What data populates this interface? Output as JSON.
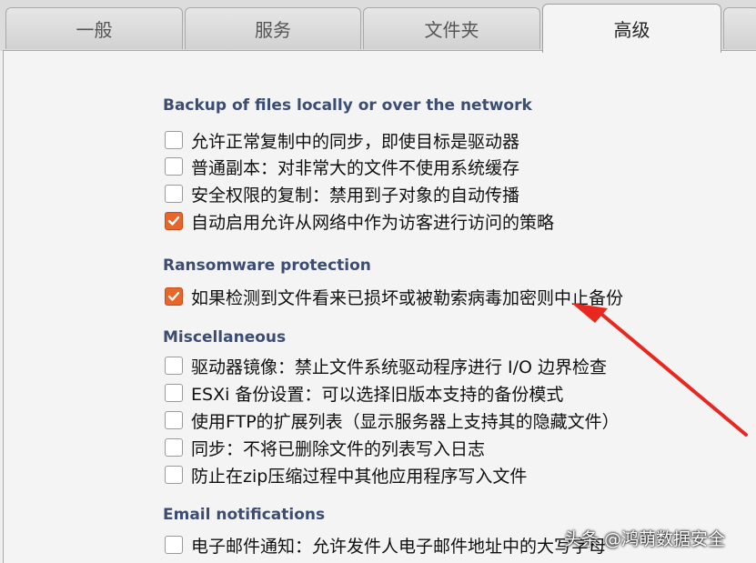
{
  "tabs": [
    {
      "label": "一般",
      "active": false
    },
    {
      "label": "服务",
      "active": false
    },
    {
      "label": "文件夹",
      "active": false
    },
    {
      "label": "高级",
      "active": true
    }
  ],
  "sections": {
    "backup": {
      "title": "Backup of files locally or over the network",
      "options": [
        {
          "label": "允许正常复制中的同步，即使目标是驱动器",
          "checked": false
        },
        {
          "label": "普通副本：对非常大的文件不使用系统缓存",
          "checked": false
        },
        {
          "label": "安全权限的复制：禁用到子对象的自动传播",
          "checked": false
        },
        {
          "label": "自动启用允许从网络中作为访客进行访问的策略",
          "checked": true
        }
      ]
    },
    "ransomware": {
      "title": "Ransomware protection",
      "options": [
        {
          "label": "如果检测到文件看来已损坏或被勒索病毒加密则中止备份",
          "checked": true
        }
      ]
    },
    "misc": {
      "title": "Miscellaneous",
      "options": [
        {
          "label": "驱动器镜像：禁止文件系统驱动程序进行 I/O 边界检查",
          "checked": false
        },
        {
          "label": "ESXi 备份设置：可以选择旧版本支持的备份模式",
          "checked": false
        },
        {
          "label": "使用FTP的扩展列表（显示服务器上支持其的隐藏文件）",
          "checked": false
        },
        {
          "label": "同步：不将已删除文件的列表写入日志",
          "checked": false
        },
        {
          "label": "防止在zip压缩过程中其他应用程序写入文件",
          "checked": false
        }
      ]
    },
    "email": {
      "title": "Email notifications",
      "options": [
        {
          "label": "电子邮件通知：允许发件人电子邮件地址中的大写字母",
          "checked": false
        }
      ]
    }
  },
  "annotation": {
    "arrow_color": "#e8281e"
  },
  "watermark": "头条 @鸿萌数据安全",
  "colors": {
    "section_title": "#3c4d73",
    "checkbox_checked": "#e8652c"
  }
}
